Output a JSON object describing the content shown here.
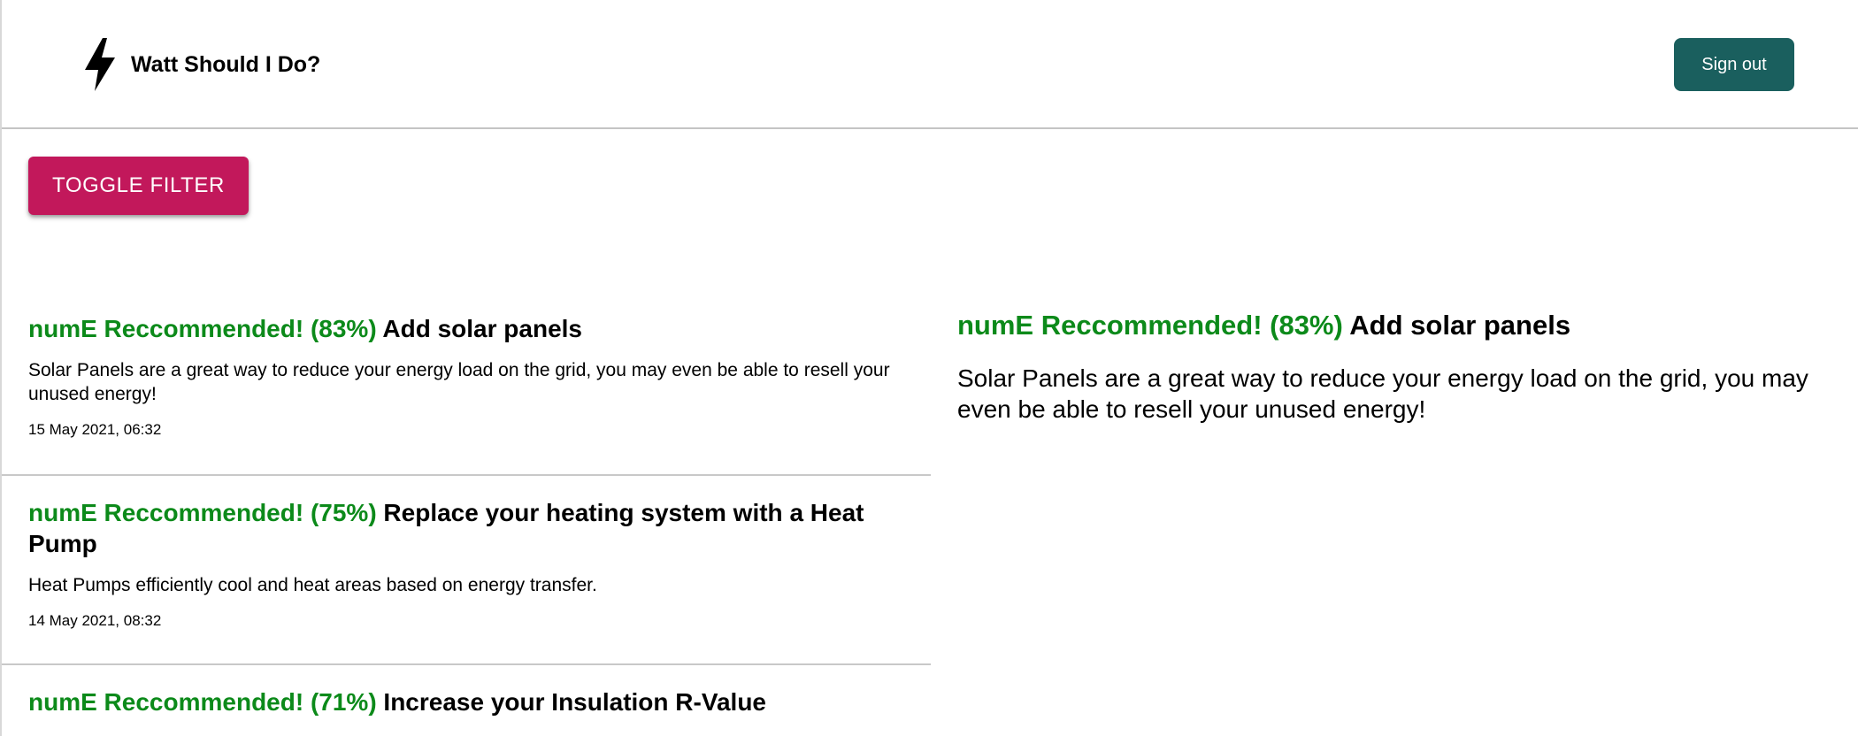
{
  "header": {
    "app_title": "Watt Should I Do?",
    "logo_icon": "lightning-bolt-icon",
    "signout_label": "Sign out"
  },
  "filter": {
    "toggle_label": "TOGGLE FILTER"
  },
  "colors": {
    "accent_pink": "#c2185b",
    "signout_teal": "#1a5f5e",
    "recommended_green": "#0c8a1a"
  },
  "recommendations": [
    {
      "badge": "numE Reccommended! (83%)",
      "title": "Add solar panels",
      "description": "Solar Panels are a great way to reduce your energy load on the grid, you may even be able to resell your unused energy!",
      "date": "15 May 2021, 06:32"
    },
    {
      "badge": "numE Reccommended! (75%)",
      "title": "Replace your heating system with a Heat Pump",
      "description": "Heat Pumps efficiently cool and heat areas based on energy transfer.",
      "date": "14 May 2021, 08:32"
    },
    {
      "badge": "numE Reccommended! (71%)",
      "title": "Increase your Insulation R-Value",
      "description": "",
      "date": ""
    }
  ],
  "detail": {
    "badge": "numE Reccommended! (83%)",
    "title": "Add solar panels",
    "description": "Solar Panels are a great way to reduce your energy load on the grid, you may even be able to resell your unused energy!"
  }
}
